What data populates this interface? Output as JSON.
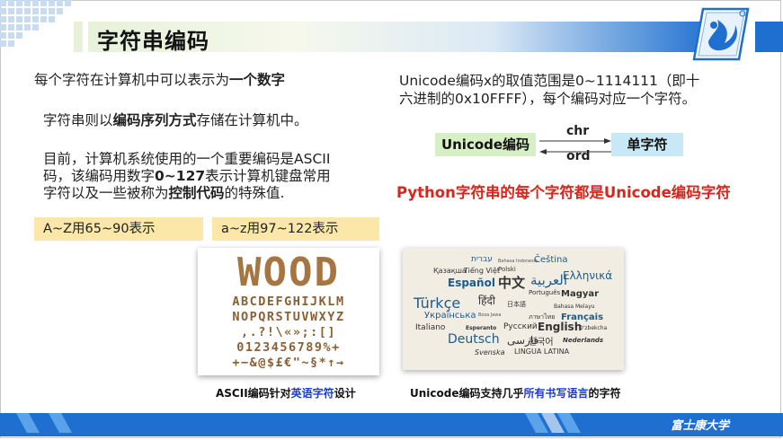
{
  "header": {
    "title": "字符串编码",
    "accent_color": "#1e6fd0"
  },
  "left": {
    "p1_pre": "每个字符在计算机中可以表示为",
    "p1_bold": "一个数字",
    "p2_pre": "字符串则以",
    "p2_bold": "编码序列方式",
    "p2_post": "存储在计算机中。",
    "p3_line1": "目前，计算机系统使用的一个重要编码是ASCII",
    "p3_line2": "码，该编码用数字",
    "p3_line2_bold": "0~127",
    "p3_line2_post": "表示计算机键盘常用",
    "p3_line3_pre": "字符以及一些被称为",
    "p3_line3_bold": "控制代码",
    "p3_line3_post": "的特殊值.",
    "tag_upper": "A~Z用65~90表示",
    "tag_lower": "a~z用97~122表示"
  },
  "right": {
    "p_line1": "Unicode编码x的取值范围是0~1114111（即十",
    "p_line2": "六进制的0x10FFFF），每个编码对应一个字符。",
    "box_unicode": "Unicode编码",
    "box_char": "单字符",
    "arrow_top": "chr",
    "arrow_bottom": "ord",
    "highlight": "Python字符串的每个字符都是Unicode编码字符",
    "highlight_color": "#d8261c"
  },
  "images": {
    "wood_word": "WOOD",
    "wood_rows": [
      "ABCDEFGHIJKLM",
      "NOPQRSTUVWXYZ",
      ",.?!\\«»;:[]",
      "0123456789%+",
      "+−&@$£€\"~§*↑→"
    ],
    "lang_words": [
      "עברית",
      "Bahasa Indonesia",
      "Čeština",
      "Қазақша",
      "Tiếng Việt",
      "Polski",
      "Ελληνικά",
      "Español",
      "中文",
      "العربية",
      "Português",
      "Magyar",
      "Türkçe",
      "हिंदी",
      "日本語",
      "Bahasa Melayu",
      "Українська",
      "Bosa Jawa",
      "ภาษาไทย",
      "Français",
      "Italiano",
      "Esperanto",
      "Русский",
      "English",
      "O'zbekcha",
      "Deutsch",
      "فارسی",
      "한국어",
      "Nederlands",
      "Svenska",
      "LINGUA LATINA"
    ]
  },
  "captions": {
    "ascii_pre": "ASCII编码针对",
    "ascii_hl": "英语字符",
    "ascii_post": "设计",
    "uni_pre": "Unicode编码支持几乎",
    "uni_hl": "所有书写语言",
    "uni_post": "的字符"
  },
  "footer": {
    "name": "富士康大学"
  }
}
